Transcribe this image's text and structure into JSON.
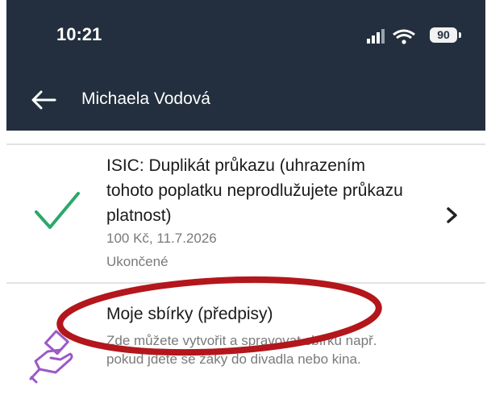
{
  "status_bar": {
    "time": "10:21",
    "battery": "90"
  },
  "header": {
    "title": "Michaela Vodová"
  },
  "items": [
    {
      "title": "ISIC: Duplikát průkazu (uhrazením tohoto poplatku neprodlužujete průkazu platnost)",
      "meta": "100 Kč, 11.7.2026",
      "status": "Ukončené",
      "icon": "check-icon"
    }
  ],
  "collections": {
    "title": "Moje sbírky (předpisy)",
    "description": "Zde můžete vytvořit a spravovat sbírku např. pokud jdete se žáky do divadla nebo kina.",
    "icon": "hand-money-icon"
  },
  "colors": {
    "header_bg": "#232f3e",
    "check": "#2ca86a",
    "hand_icon": "#9b59c6",
    "annotation_circle": "#b3161b"
  }
}
